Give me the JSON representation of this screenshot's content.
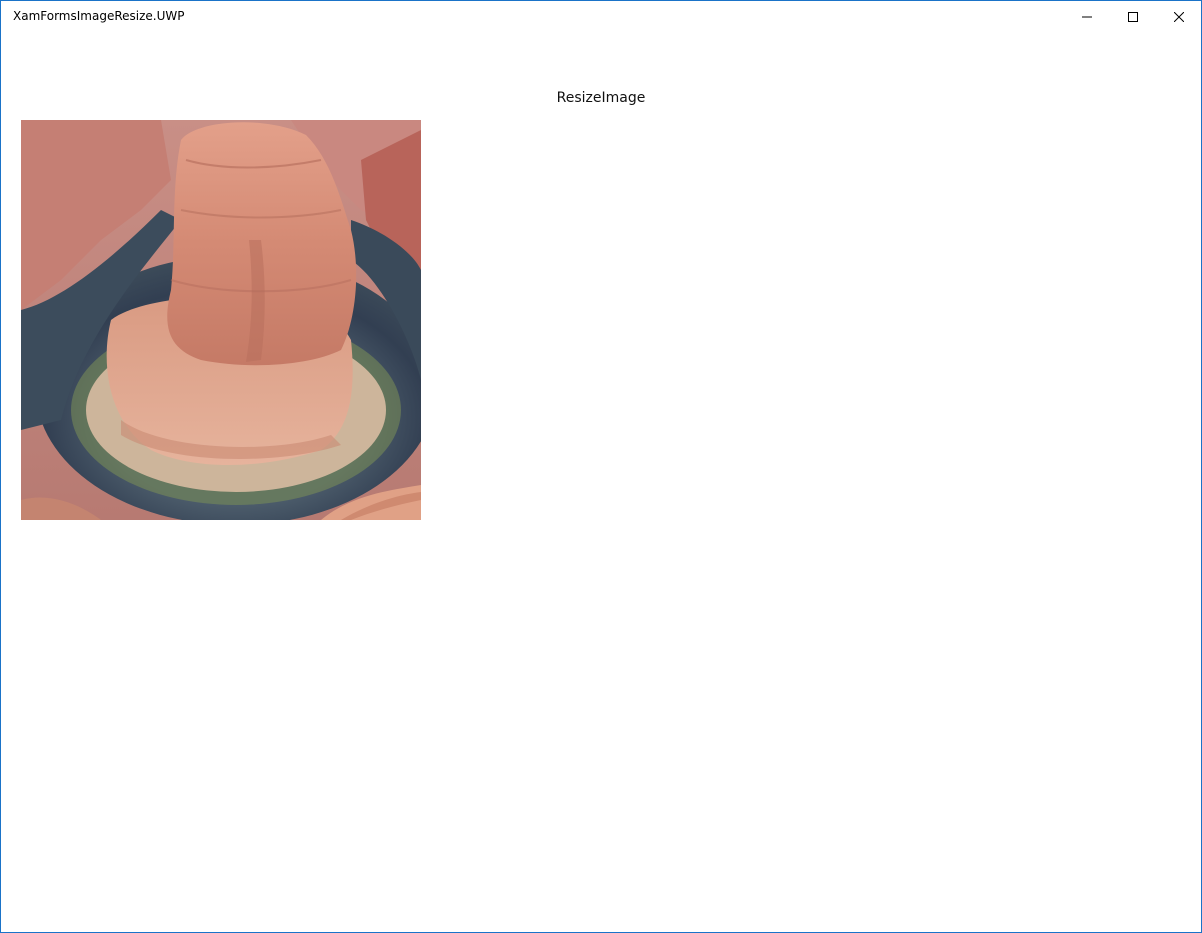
{
  "window": {
    "title": "XamFormsImageResize.UWP"
  },
  "caption_buttons": {
    "minimize_icon": "minimize-icon",
    "maximize_icon": "maximize-icon",
    "close_icon": "close-icon"
  },
  "page": {
    "title": "ResizeImage"
  },
  "image": {
    "description_icon": "canyon-photo",
    "colors": {
      "rock": "#d9907a",
      "rock_dark": "#b96a57",
      "river": "#3a4a5c",
      "sand": "#e8c8a8",
      "vegetation": "#6f8a4a"
    }
  },
  "accent_color": "#1a73c8"
}
